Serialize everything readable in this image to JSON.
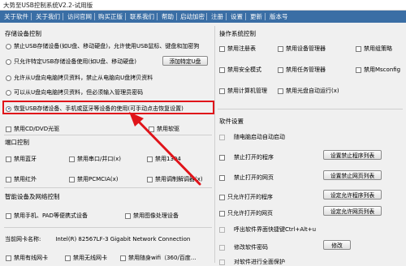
{
  "window": {
    "title": "大势至USB控制系统V2.2-试用版"
  },
  "menu": [
    "关于软件",
    "关于我们",
    "访问官网",
    "购买正版",
    "联系我们",
    "帮助",
    "启动加密",
    "注册",
    "设置",
    "更新",
    "版本号"
  ],
  "storage": {
    "title": "存储设备控制",
    "opt1": "禁止USB存储设备(如U盘、移动硬盘)，允许使用USB鼠标、键盘和加密狗",
    "opt2": "只允许特定USB存储设备使用(如U盘、移动硬盘)",
    "opt2_button": "添加特定U盘",
    "opt3": "允许从U盘向电脑拷贝资料，禁止从电脑向U盘拷贝资料",
    "opt4": "可以从U盘向电脑拷贝资料，但必须输入管理员密码",
    "opt5": "恢复USB存储设备、手机或蓝牙等设备的使用(可手动点击恢复设置)",
    "cd": "禁用CD/DVD光驱",
    "floppy": "禁用软驱"
  },
  "ports": {
    "title": "端口控制",
    "bluetooth": "禁用蓝牙",
    "serial": "禁用串口/并口(x)",
    "ieee": "禁用1394",
    "infrared": "禁用红外",
    "pcmcia": "禁用PCMCIA(x)",
    "modem": "禁用调制解调器(x)"
  },
  "smart": {
    "title": "智能设备及网络控制",
    "phone": "禁用手机、PAD等便携式设备",
    "imaging": "禁用图像处理设备"
  },
  "nic": {
    "label": "当前网卡名称:",
    "value": "Intel(R) 82567LF-3 Gigabit Network Connection",
    "bottom1": "禁用有线网卡",
    "bottom2": "禁用无线网卡",
    "bottom3": "禁用随身wifi（360/百度…"
  },
  "os": {
    "title": "操作系统控制",
    "registry": "禁用注册表",
    "device_mgr": "禁用设备管理器",
    "group_policy": "禁用组策略",
    "safe_mode": "禁用安全模式",
    "task_mgr": "禁用任务管理器",
    "msconfig": "禁用Msconfig",
    "computer_mgmt": "禁用计算机管理",
    "autorun": "禁用光盘自动运行(x)"
  },
  "software": {
    "title": "软件设置",
    "autostart": "随电脑启动自动启动",
    "block_prog": "禁止打开的程序",
    "block_prog_btn": "设置禁止程序列表",
    "block_web": "禁止打开的网页",
    "block_web_btn": "设置禁止网页列表",
    "allow_prog": "只允许打开的程序",
    "allow_prog_btn": "设定允许程序列表",
    "allow_web": "只允许打开的网页",
    "allow_web_btn": "设定允许网页列表",
    "hotkey": "呼出软件界面快捷键Ctrl+Alt+u",
    "pwd": "修改软件密码",
    "pwd_btn": "修改",
    "hide": "对软件进行全面保护"
  },
  "colors": {
    "menubar": "#3a6ea5",
    "highlight": "#e0141a",
    "arrow": "#e0141a"
  }
}
